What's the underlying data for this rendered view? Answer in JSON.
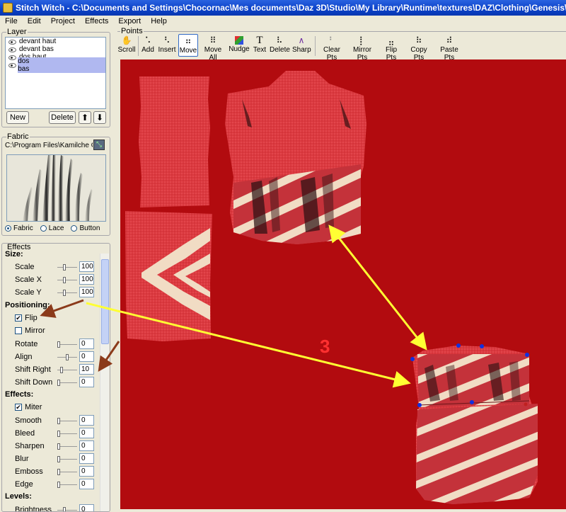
{
  "window": {
    "title": "Stitch Witch - C:\\Documents and Settings\\Chocornac\\Mes documents\\Daz 3D\\Studio\\My Library\\Runtime\\textures\\DAZ\\Clothing\\Genesis\\Copie de MFD_Dany66\\blo"
  },
  "menu": [
    "File",
    "Edit",
    "Project",
    "Effects",
    "Export",
    "Help"
  ],
  "layer": {
    "legend": "Layer",
    "items": [
      "devant haut",
      "devant bas",
      "dos haut",
      "dos bas"
    ],
    "selected": "dos bas",
    "new_label": "New",
    "delete_label": "Delete"
  },
  "fabric": {
    "legend": "Fabric",
    "path": "C:\\Program Files\\Kamilche Co",
    "type_options": [
      "Fabric",
      "Lace",
      "Button"
    ],
    "selected_type": "Fabric"
  },
  "effects": {
    "legend": "Effects",
    "size_heading": "Size:",
    "scale_label": "Scale",
    "scale_value": "100",
    "scalex_label": "Scale X",
    "scalex_value": "100",
    "scaley_label": "Scale Y",
    "scaley_value": "100",
    "positioning_heading": "Positioning:",
    "flip_label": "Flip",
    "flip_checked": true,
    "mirror_label": "Mirror",
    "mirror_checked": false,
    "rotate_label": "Rotate",
    "rotate_value": "0",
    "align_label": "Align",
    "align_value": "0",
    "shiftright_label": "Shift Right",
    "shiftright_value": "10",
    "shiftdown_label": "Shift Down",
    "shiftdown_value": "0",
    "effects_heading": "Effects:",
    "miter_label": "Miter",
    "miter_checked": true,
    "smooth_label": "Smooth",
    "smooth_value": "0",
    "bleed_label": "Bleed",
    "bleed_value": "0",
    "sharpen_label": "Sharpen",
    "sharpen_value": "0",
    "blur_label": "Blur",
    "blur_value": "0",
    "emboss_label": "Emboss",
    "emboss_value": "0",
    "edge_label": "Edge",
    "edge_value": "0",
    "levels_heading": "Levels:",
    "brightness_label": "Brightness",
    "brightness_value": "0"
  },
  "points": {
    "legend": "Points",
    "tools": [
      {
        "label": "Scroll",
        "icon": "hand-icon"
      },
      {
        "label": "Add",
        "icon": "add-points-icon"
      },
      {
        "label": "Insert",
        "icon": "insert-points-icon"
      },
      {
        "label": "Move",
        "icon": "move-points-icon",
        "active": true
      },
      {
        "label": "Move All",
        "icon": "move-all-icon"
      },
      {
        "label": "Nudge",
        "icon": "nudge-icon"
      },
      {
        "label": "Text",
        "icon": "text-icon"
      },
      {
        "label": "Delete",
        "icon": "delete-points-icon"
      },
      {
        "label": "Sharp",
        "icon": "sharp-icon"
      },
      {
        "label": "Clear Pts",
        "icon": "clear-points-icon"
      },
      {
        "label": "Mirror Pts",
        "icon": "mirror-points-icon"
      },
      {
        "label": "Flip Pts",
        "icon": "flip-points-icon"
      },
      {
        "label": "Copy Pts",
        "icon": "copy-points-icon"
      },
      {
        "label": "Paste Pts",
        "icon": "paste-points-icon"
      }
    ]
  },
  "canvas": {
    "annotation_number": "3",
    "colors": {
      "background": "#b20b0f",
      "fabric": "#d8343a",
      "arrow": "#ffff33",
      "brown_arrow": "#8b3a1a",
      "point": "#1030e0"
    }
  }
}
